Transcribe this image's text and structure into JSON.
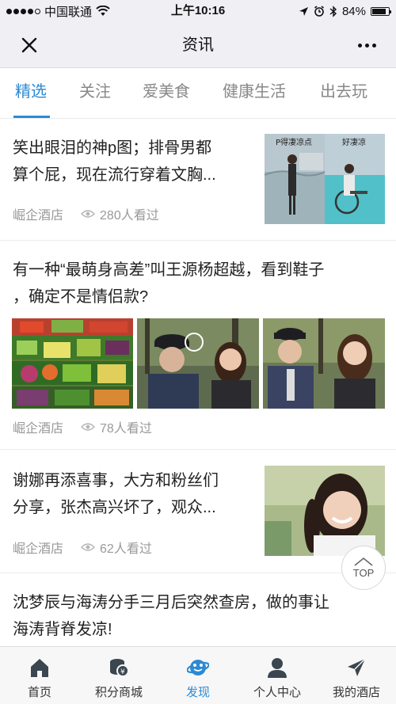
{
  "status_bar": {
    "carrier": "中国联通",
    "time": "上午10:16",
    "battery": "84%",
    "battery_level": 0.84
  },
  "header": {
    "title": "资讯",
    "close_icon": "close-icon",
    "more_icon": "more-icon"
  },
  "tabs": [
    {
      "label": "精选",
      "active": true
    },
    {
      "label": "关注",
      "active": false
    },
    {
      "label": "爱美食",
      "active": false
    },
    {
      "label": "健康生活",
      "active": false
    },
    {
      "label": "出去玩",
      "active": false
    }
  ],
  "feed": [
    {
      "title_line1": "笑出眼泪的神p图；排骨男都",
      "title_line2": "算个屁，现在流行穿着文胸...",
      "source": "崛企酒店",
      "views": "280人看过",
      "thumb_captions": [
        "P得凄凉点",
        "好凄凉"
      ]
    },
    {
      "title_line1": "有一种“最萌身高差”叫王源杨超越，看到鞋子",
      "title_line2": "，确定不是情侣款?",
      "source": "崛企酒店",
      "views": "78人看过"
    },
    {
      "title_line1": "谢娜再添喜事，大方和粉丝们",
      "title_line2": "分享，张杰高兴坏了，观众...",
      "source": "崛企酒店",
      "views": "62人看过"
    },
    {
      "title_line1": "沈梦辰与海涛分手三月后突然查房，做的事让",
      "title_line2": "海涛背脊发凉!"
    }
  ],
  "top_button": {
    "label": "TOP"
  },
  "tabbar": [
    {
      "label": "首页",
      "icon": "home-icon",
      "active": false
    },
    {
      "label": "积分商城",
      "icon": "coins-icon",
      "active": false
    },
    {
      "label": "发现",
      "icon": "discover-icon",
      "active": true
    },
    {
      "label": "个人中心",
      "icon": "user-icon",
      "active": false
    },
    {
      "label": "我的酒店",
      "icon": "send-icon",
      "active": false
    }
  ],
  "colors": {
    "accent": "#2c8ad4",
    "nav_bg": "#efeff4",
    "meta_text": "#9a9a9a"
  }
}
